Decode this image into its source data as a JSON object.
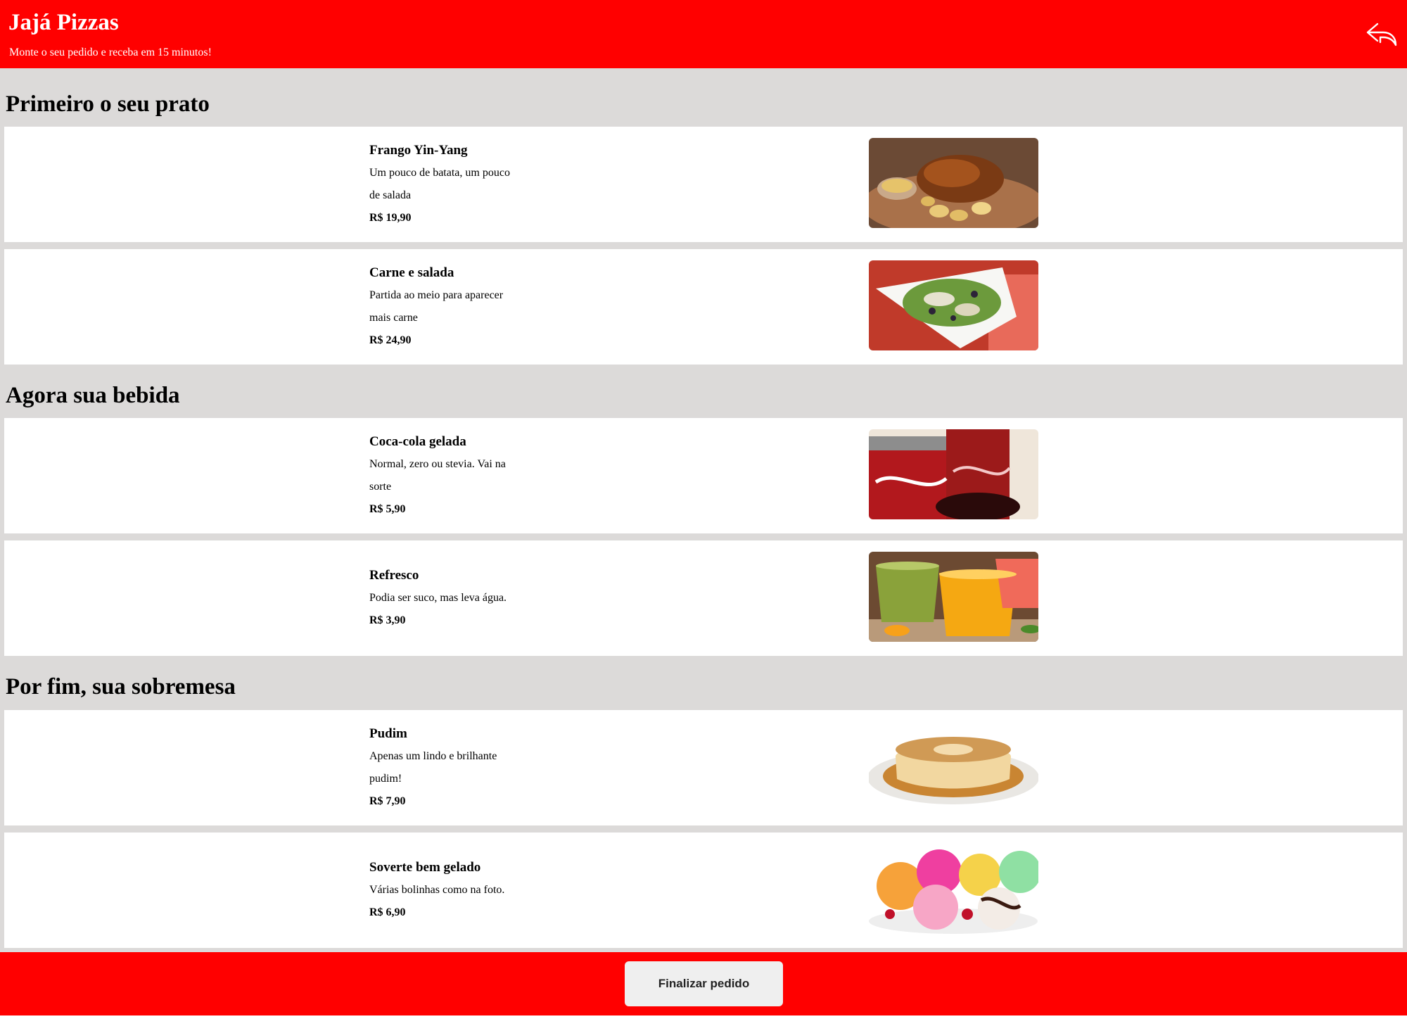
{
  "header": {
    "brand": "Jajá Pizzas",
    "tagline": "Monte o seu pedido e receba em 15 minutos!",
    "back_icon": "reply-arrow-icon",
    "color": "#ff0000"
  },
  "sections": [
    {
      "title": "Primeiro o seu prato",
      "items": [
        {
          "name": "Frango Yin-Yang",
          "desc1": "Um pouco de batata, um pouco",
          "desc2": "de salada",
          "price": "R$ 19,90",
          "image": "roast-chicken-image"
        },
        {
          "name": "Carne e salada",
          "desc1": "Partida ao meio para aparecer",
          "desc2": "mais carne",
          "price": "R$ 24,90",
          "image": "salad-bowl-image"
        }
      ]
    },
    {
      "title": "Agora sua bebida",
      "items": [
        {
          "name": "Coca-cola gelada",
          "desc1": "Normal, zero ou stevia. Vai na",
          "desc2": "sorte",
          "price": "R$ 5,90",
          "image": "cola-cans-image"
        },
        {
          "name": "Refresco",
          "desc1": "Podia ser suco, mas leva água.",
          "desc2": "",
          "price": "R$ 3,90",
          "image": "juice-glasses-image"
        }
      ]
    },
    {
      "title": "Por fim, sua sobremesa",
      "items": [
        {
          "name": "Pudim",
          "desc1": "Apenas um lindo e brilhante",
          "desc2": "pudim!",
          "price": "R$ 7,90",
          "image": "pudding-image"
        },
        {
          "name": "Soverte bem gelado",
          "desc1": "Várias bolinhas como na foto.",
          "desc2": "",
          "price": "R$ 6,90",
          "image": "ice-cream-image"
        }
      ]
    }
  ],
  "footer": {
    "finish_label": "Finalizar pedido"
  }
}
